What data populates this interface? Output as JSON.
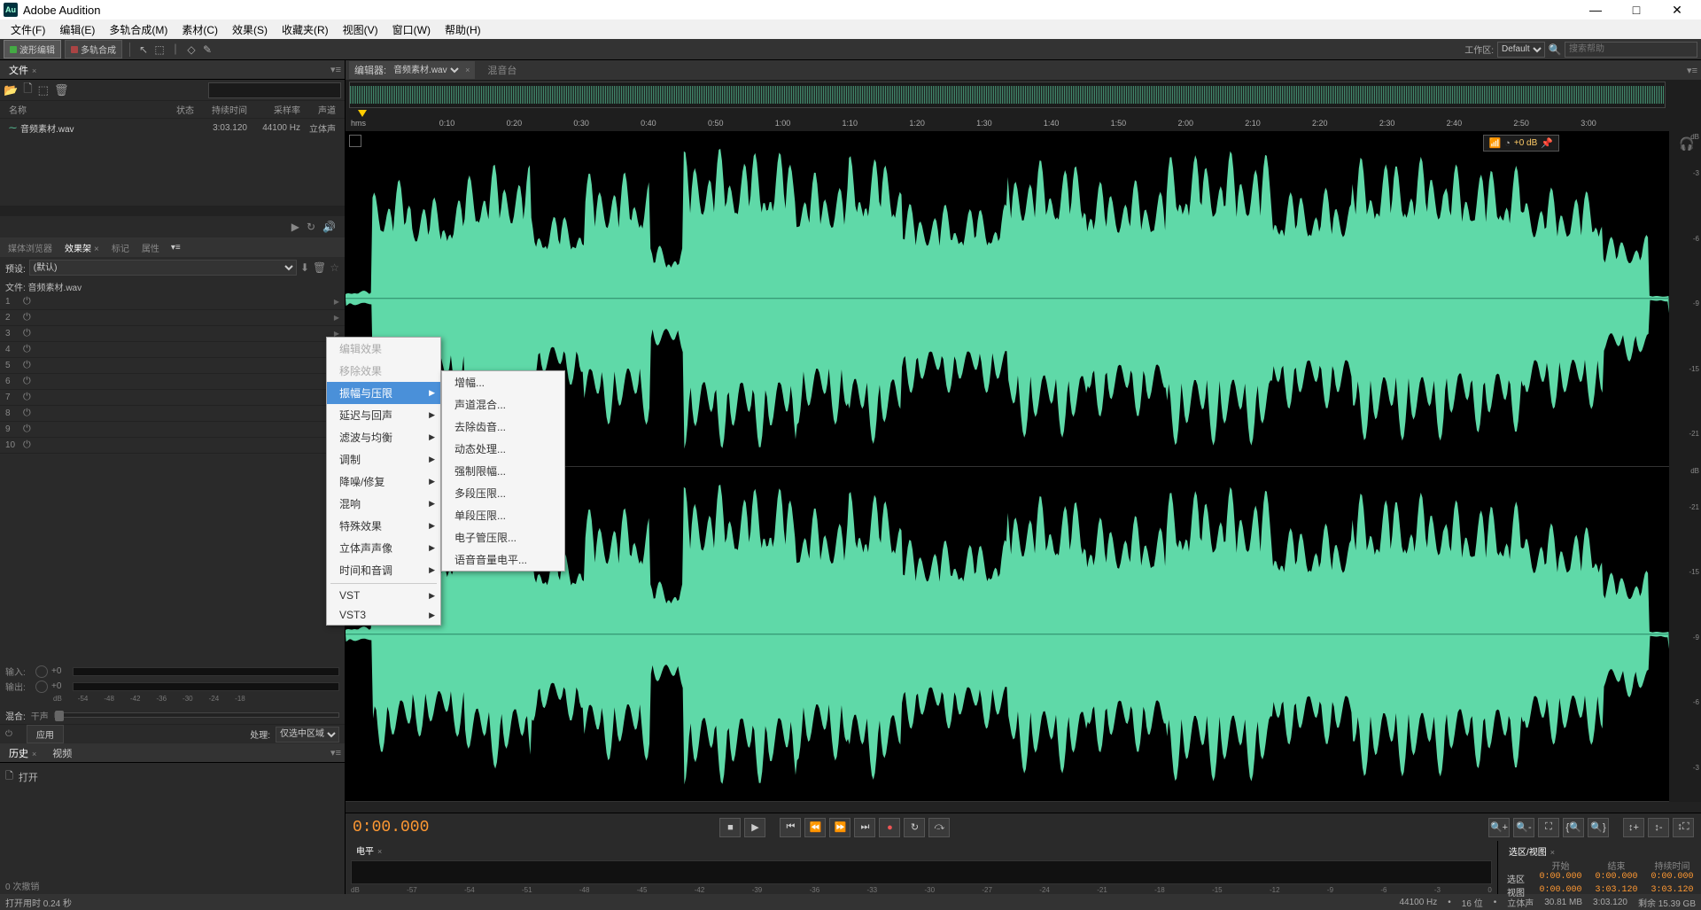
{
  "app": {
    "title": "Adobe Audition",
    "icon_text": "Au"
  },
  "window_controls": {
    "min": "—",
    "max": "□",
    "close": "✕"
  },
  "menubar": [
    "文件(F)",
    "编辑(E)",
    "多轨合成(M)",
    "素材(C)",
    "效果(S)",
    "收藏夹(R)",
    "视图(V)",
    "窗口(W)",
    "帮助(H)"
  ],
  "toolbar": {
    "mode_wave": "波形编辑",
    "mode_multi": "多轨合成",
    "workspace_label": "工作区:",
    "workspace_value": "Default",
    "search_placeholder": "搜索帮助"
  },
  "files_panel": {
    "tab": "文件",
    "search_placeholder": "",
    "columns": {
      "name": "名称",
      "status": "状态",
      "duration": "持续时间",
      "rate": "采样率",
      "channels": "声道"
    },
    "rows": [
      {
        "name": "音频素材.wav",
        "status": "",
        "duration": "3:03.120",
        "rate": "44100 Hz",
        "channels": "立体声"
      }
    ]
  },
  "rack": {
    "tabs": [
      "媒体浏览器",
      "效果架",
      "标记",
      "属性"
    ],
    "active_tab": 1,
    "preset_label": "预设:",
    "preset_value": "(默认)",
    "file_label": "文件: 音频素材.wav",
    "slot_count": 10,
    "input_label": "输入:",
    "output_label": "输出:",
    "io_val": "+0",
    "scale": [
      "dB",
      "-54",
      "-48",
      "-42",
      "-36",
      "-30",
      "-24",
      "-18"
    ],
    "mix_label": "混合:",
    "mix_val": "干声",
    "apply": "应用",
    "process_label": "处理:",
    "process_value": "仅选中区域"
  },
  "history": {
    "tabs": [
      "历史",
      "视频"
    ],
    "item": "打开",
    "undo_count": "0 次撤销"
  },
  "editor": {
    "tab_label": "编辑器:",
    "file": "音频素材.wav",
    "tab_mixer": "混音台",
    "ruler_start": "hms",
    "ticks": [
      "0:10",
      "0:20",
      "0:30",
      "0:40",
      "0:50",
      "1:00",
      "1:10",
      "1:20",
      "1:30",
      "1:40",
      "1:50",
      "2:00",
      "2:10",
      "2:20",
      "2:30",
      "2:40",
      "2:50",
      "3:00"
    ],
    "db_top": "dB",
    "db_marks": [
      "-3",
      "-6",
      "-9",
      "-15",
      "-21",
      "-21",
      "-15",
      "-9",
      "-6",
      "-3"
    ],
    "hud_val": "+0 dB",
    "timecode": "0:00.000"
  },
  "levels": {
    "tab": "电平",
    "scale": [
      "dB",
      "-57",
      "-54",
      "-51",
      "-48",
      "-45",
      "-42",
      "-39",
      "-36",
      "-33",
      "-30",
      "-27",
      "-24",
      "-21",
      "-18",
      "-15",
      "-12",
      "-9",
      "-6",
      "-3",
      "0"
    ],
    "right_tab": "选区/视图",
    "cols": [
      "开始",
      "结束",
      "持续时间"
    ],
    "sel_label": "选区",
    "sel": [
      "0:00.000",
      "0:00.000",
      "0:00.000"
    ],
    "view_label": "视图",
    "view": [
      "0:00.000",
      "3:03.120",
      "3:03.120"
    ]
  },
  "status": {
    "left": "打开用时 0.24 秒",
    "rate": "44100 Hz",
    "bits": "16 位",
    "ch": "立体声",
    "size": "30.81 MB",
    "dur": "3:03.120",
    "disk": "剩余 15.39 GB"
  },
  "context1": {
    "items": [
      {
        "label": "编辑效果",
        "disabled": true
      },
      {
        "label": "移除效果",
        "disabled": true
      },
      {
        "label": "振幅与压限",
        "arrow": true,
        "highlight": true
      },
      {
        "label": "延迟与回声",
        "arrow": true
      },
      {
        "label": "滤波与均衡",
        "arrow": true
      },
      {
        "label": "调制",
        "arrow": true
      },
      {
        "label": "降噪/修复",
        "arrow": true
      },
      {
        "label": "混响",
        "arrow": true
      },
      {
        "label": "特殊效果",
        "arrow": true
      },
      {
        "label": "立体声声像",
        "arrow": true
      },
      {
        "label": "时间和音调",
        "arrow": true
      },
      {
        "sep": true
      },
      {
        "label": "VST",
        "arrow": true
      },
      {
        "label": "VST3",
        "arrow": true
      }
    ]
  },
  "context2": {
    "items": [
      {
        "label": "增幅..."
      },
      {
        "label": "声道混合..."
      },
      {
        "label": "去除齿音..."
      },
      {
        "label": "动态处理..."
      },
      {
        "label": "强制限幅..."
      },
      {
        "label": "多段压限..."
      },
      {
        "label": "单段压限..."
      },
      {
        "label": "电子管压限..."
      },
      {
        "label": "语音音量电平..."
      }
    ]
  }
}
